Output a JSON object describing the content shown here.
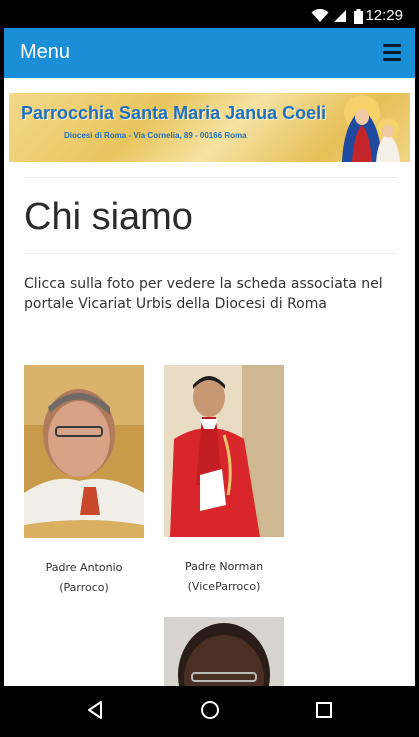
{
  "status_bar": {
    "time": "12:29",
    "icons": [
      "wifi-icon",
      "signal-icon",
      "battery-icon"
    ]
  },
  "app_bar": {
    "title": "Menu",
    "menu_icon": "hamburger-menu-icon",
    "color": "#1a8fd8"
  },
  "banner": {
    "title": "Parrocchia Santa Maria Janua Coeli",
    "subtitle": "Diocesi di Roma - Via Cornelia, 89 - 00166 Roma"
  },
  "main": {
    "heading": "Chi siamo",
    "intro": "Clicca sulla foto per vedere la scheda associata nel portale Vicariat Urbis della Diocesi di Roma",
    "clergy": [
      {
        "name": "Padre Antonio",
        "role": "(Parroco)"
      },
      {
        "name": "Padre Norman",
        "role": "(ViceParroco)"
      }
    ]
  },
  "nav_bar": {
    "buttons": [
      "back-icon",
      "home-icon",
      "recents-icon"
    ]
  }
}
